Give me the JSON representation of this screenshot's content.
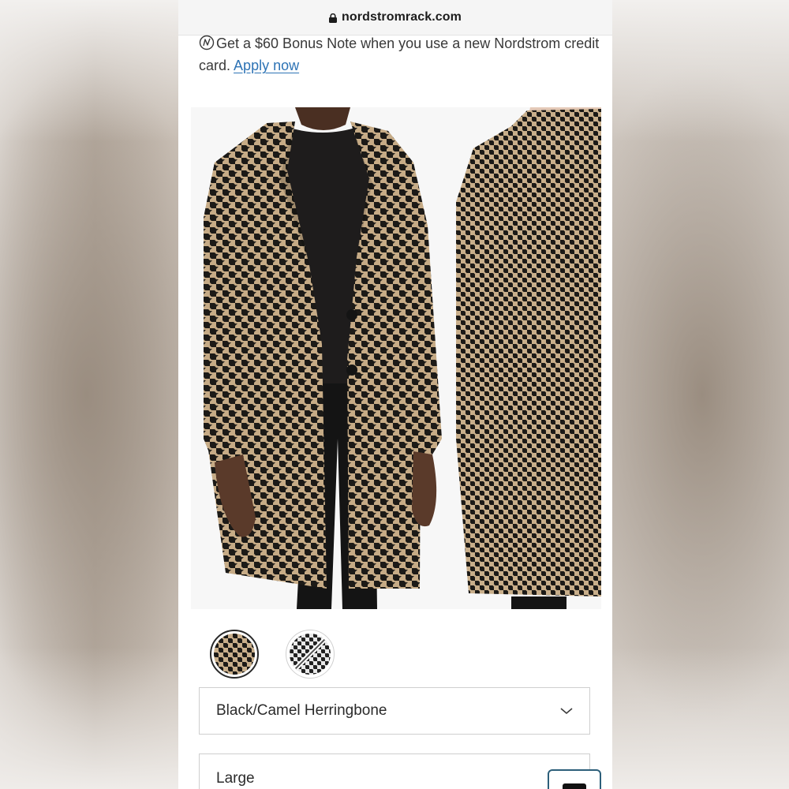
{
  "browser": {
    "url": "nordstromrack.com"
  },
  "promo": {
    "icon": "nordstrom-note-icon",
    "text": "Get a $60 Bonus Note when you use a new Nordstrom credit card.",
    "link_label": "Apply now"
  },
  "gallery": {
    "images": [
      "product-front-image",
      "product-back-image"
    ]
  },
  "color_options": {
    "swatches": [
      "black-camel-swatch",
      "black-white-swatch-unavailable"
    ],
    "selected_index": 0
  },
  "color_select": {
    "value": "Black/Camel Herringbone"
  },
  "size_select": {
    "value": "Large"
  },
  "colors": {
    "camel": "#c9b08e",
    "black": "#1b1a18",
    "link": "#2d73b5"
  }
}
